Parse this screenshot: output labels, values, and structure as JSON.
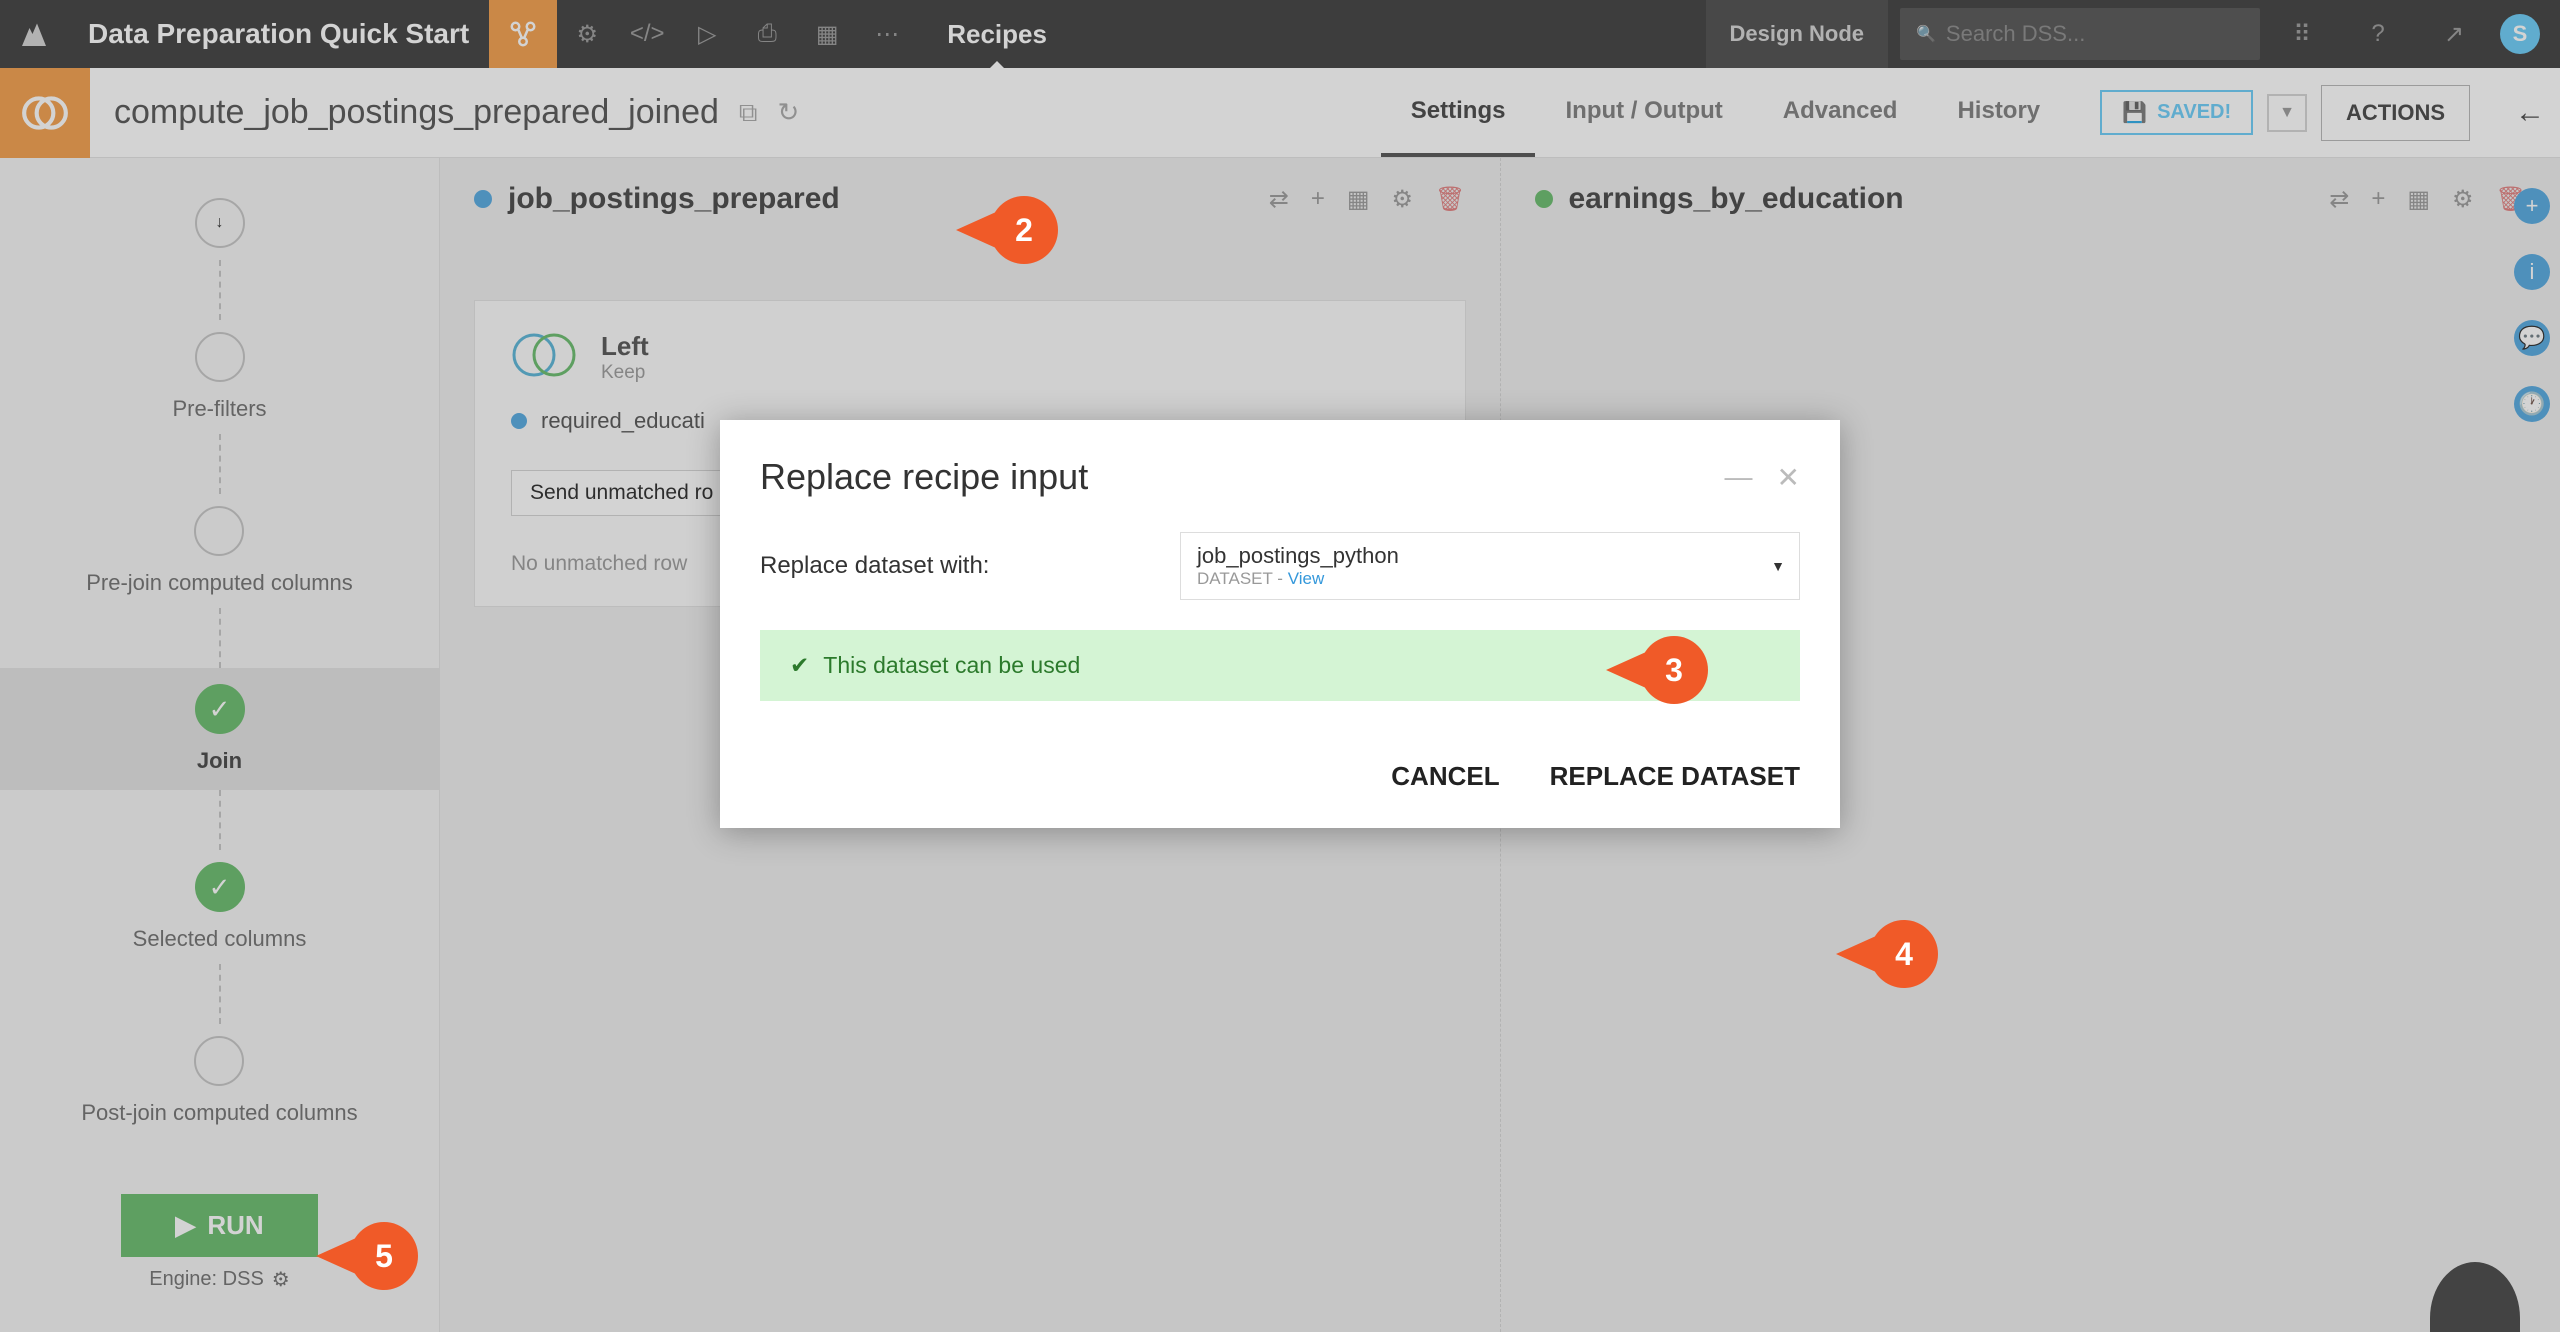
{
  "topbar": {
    "title": "Data Preparation Quick Start",
    "tab": "Recipes",
    "design_node": "Design Node",
    "search_placeholder": "Search DSS...",
    "avatar_initial": "S"
  },
  "subheader": {
    "title": "compute_job_postings_prepared_joined",
    "tabs": {
      "settings": "Settings",
      "io": "Input / Output",
      "advanced": "Advanced",
      "history": "History"
    },
    "saved": "SAVED!",
    "actions": "ACTIONS"
  },
  "steps": {
    "prefilters": "Pre-filters",
    "prejoin": "Pre-join computed columns",
    "join": "Join",
    "selected": "Selected columns",
    "postjoin": "Post-join computed columns",
    "run": "RUN",
    "engine": "Engine: DSS"
  },
  "datasets": {
    "left": {
      "name": "job_postings_prepared",
      "dot_color": "#3498db"
    },
    "right": {
      "name": "earnings_by_education",
      "dot_color": "#4CAF50"
    }
  },
  "join_box": {
    "type_label": "Left",
    "type_sub": "Keep",
    "column": "required_educati",
    "send_unmatched": "Send unmatched ro",
    "no_unmatched": "No unmatched row"
  },
  "modal": {
    "title": "Replace recipe input",
    "label": "Replace dataset with:",
    "select_value": "job_postings_python",
    "select_sub_prefix": "DATASET - ",
    "select_sub_link": "View",
    "success": "This dataset can be used",
    "cancel": "CANCEL",
    "replace": "REPLACE DATASET"
  },
  "callouts": {
    "c2": "2",
    "c3": "3",
    "c4": "4",
    "c5": "5"
  }
}
